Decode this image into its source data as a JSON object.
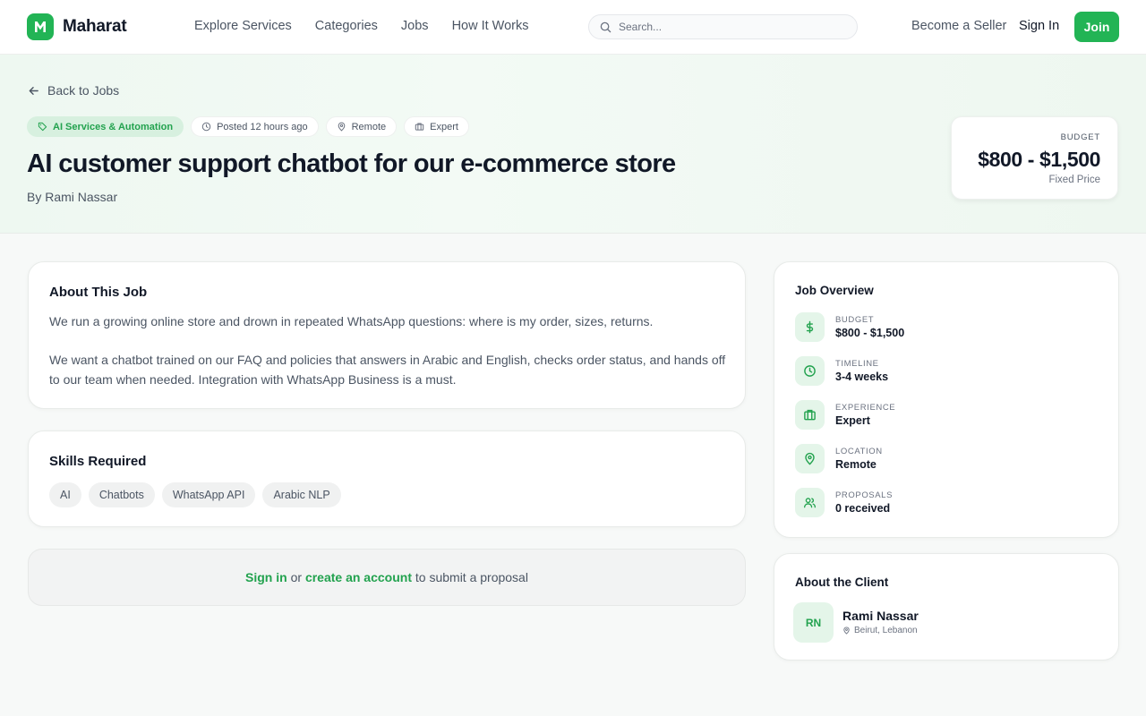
{
  "brand": {
    "name": "Maharat",
    "logo_letter": "M",
    "accent": "#22b455"
  },
  "nav": [
    "Explore Services",
    "Categories",
    "Jobs",
    "How It Works"
  ],
  "search": {
    "placeholder": "Search..."
  },
  "header_actions": {
    "become_seller": "Become a Seller",
    "sign_in": "Sign In",
    "join": "Join"
  },
  "hero": {
    "back": "Back to Jobs",
    "tags": {
      "category": "AI Services & Automation",
      "posted": "Posted 12 hours ago",
      "location": "Remote",
      "level": "Expert"
    },
    "title": "AI customer support chatbot for our e-commerce store",
    "by": "By Rami Nassar",
    "budget": {
      "label": "BUDGET",
      "value": "$800 - $1,500",
      "type": "Fixed Price"
    }
  },
  "about": {
    "heading": "About This Job",
    "p1": "We run a growing online store and drown in repeated WhatsApp questions: where is my order, sizes, returns.",
    "p2": "We want a chatbot trained on our FAQ and policies that answers in Arabic and English, checks order status, and hands off to our team when needed. Integration with WhatsApp Business is a must."
  },
  "skills": {
    "heading": "Skills Required",
    "items": [
      "AI",
      "Chatbots",
      "WhatsApp API",
      "Arabic NLP"
    ]
  },
  "cta": {
    "sign_in": "Sign in",
    "or": " or ",
    "create": "create an account",
    "suffix": " to submit a proposal"
  },
  "overview": {
    "heading": "Job Overview",
    "items": [
      {
        "icon": "dollar-icon",
        "label": "BUDGET",
        "value": "$800 - $1,500"
      },
      {
        "icon": "clock-icon",
        "label": "TIMELINE",
        "value": "3-4 weeks"
      },
      {
        "icon": "briefcase-icon",
        "label": "EXPERIENCE",
        "value": "Expert"
      },
      {
        "icon": "location-pin-icon",
        "label": "LOCATION",
        "value": "Remote"
      },
      {
        "icon": "users-icon",
        "label": "PROPOSALS",
        "value": "0 received"
      }
    ]
  },
  "client": {
    "heading": "About the Client",
    "initials": "RN",
    "name": "Rami Nassar",
    "location": "Beirut, Lebanon"
  }
}
